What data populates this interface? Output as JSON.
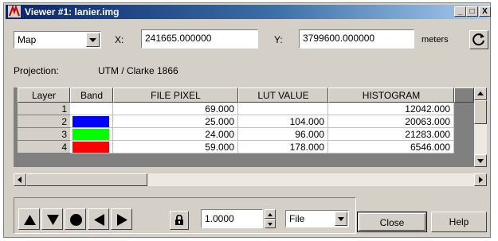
{
  "window": {
    "title": "Viewer #1:  lanier.img",
    "minimize_label": "_",
    "maximize_label": "□",
    "close_label": "X"
  },
  "coords": {
    "type_selected": "Map",
    "x_label": "X:",
    "x_value": "241665.000000",
    "y_label": "Y:",
    "y_value": "3799600.000000",
    "units": "meters"
  },
  "projection": {
    "label": "Projection:",
    "value": "UTM / Clarke 1866"
  },
  "table": {
    "headers": [
      "Layer",
      "Band",
      "FILE PIXEL",
      "LUT VALUE",
      "HISTOGRAM"
    ],
    "rows": [
      {
        "layer": "1",
        "band_color": "#ffffff",
        "file_pixel": "69.000",
        "lut_value": "",
        "histogram": "12042.000"
      },
      {
        "layer": "2",
        "band_color": "#0000ff",
        "file_pixel": "25.000",
        "lut_value": "104.000",
        "histogram": "20063.000"
      },
      {
        "layer": "3",
        "band_color": "#00ff00",
        "file_pixel": "24.000",
        "lut_value": "96.000",
        "histogram": "21283.000"
      },
      {
        "layer": "4",
        "band_color": "#ff0000",
        "file_pixel": "59.000",
        "lut_value": "178.000",
        "histogram": "6546.000"
      }
    ]
  },
  "toolbar": {
    "up_icon": "arrow-up-icon",
    "down_icon": "arrow-down-icon",
    "center_icon": "dot-icon",
    "left_icon": "arrow-left-icon",
    "right_icon": "arrow-right-icon",
    "lock_icon": "lock-icon",
    "step_value": "1.0000",
    "source_selected": "File",
    "close_label": "Close",
    "help_label": "Help"
  }
}
